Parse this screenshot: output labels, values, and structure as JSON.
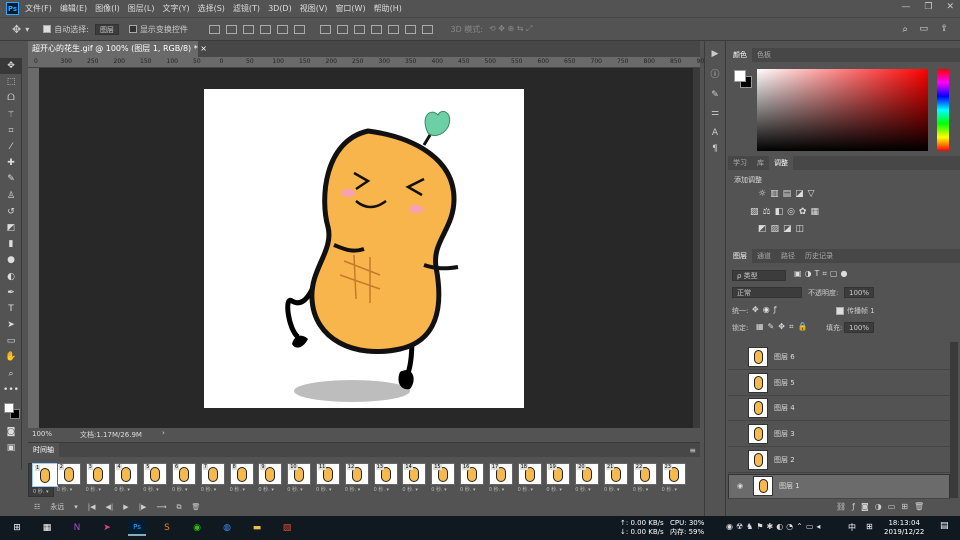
{
  "menubar": {
    "items": [
      "文件(F)",
      "编辑(E)",
      "图像(I)",
      "图层(L)",
      "文字(Y)",
      "选择(S)",
      "滤镜(T)",
      "3D(D)",
      "视图(V)",
      "窗口(W)",
      "帮助(H)"
    ]
  },
  "options": {
    "auto_select_label": "自动选择:",
    "auto_select_value": "图层",
    "show_transform_label": "显示变换控件",
    "mode_3d_label": "3D 模式:"
  },
  "document": {
    "tab_title": "超开心的花生.gif @ 100% (图层 1, RGB/8) *",
    "zoom": "100%",
    "doc_size": "文档:1.17M/26.9M"
  },
  "ruler": {
    "ticks": [
      "0",
      "300",
      "250",
      "200",
      "150",
      "100",
      "50",
      "0",
      "50",
      "100",
      "150",
      "200",
      "250",
      "300",
      "350",
      "400",
      "450",
      "500",
      "550",
      "600",
      "650",
      "700",
      "750",
      "800",
      "850",
      "900"
    ]
  },
  "timeline": {
    "tab_label": "时间轴",
    "loop_label": "永远",
    "frame_time": "0 秒.",
    "frames": [
      "1",
      "2",
      "3",
      "4",
      "5",
      "6",
      "7",
      "8",
      "9",
      "10",
      "11",
      "12",
      "13",
      "14",
      "15",
      "16",
      "17",
      "18",
      "19",
      "20",
      "21",
      "22",
      "23"
    ]
  },
  "color_panel": {
    "tabs": [
      "颜色",
      "色板"
    ],
    "foreground": "#ffffff",
    "background": "#000000"
  },
  "adjust_panel": {
    "tabs": [
      "学习",
      "库",
      "调整"
    ],
    "title": "添加调整"
  },
  "layers_panel": {
    "tabs": [
      "图层",
      "通道",
      "路径",
      "历史记录"
    ],
    "filter_label": "ρ 类型",
    "blend_mode": "正常",
    "opacity_label": "不透明度:",
    "opacity_value": "100%",
    "unify_label": "统一:",
    "propagate_label": "传播帧 1",
    "lock_label": "锁定:",
    "fill_label": "填充:",
    "fill_value": "100%",
    "layers": [
      {
        "name": "图层 6",
        "selected": false
      },
      {
        "name": "图层 5",
        "selected": false
      },
      {
        "name": "图层 4",
        "selected": false
      },
      {
        "name": "图层 3",
        "selected": false
      },
      {
        "name": "图层 2",
        "selected": false
      },
      {
        "name": "图层 1",
        "selected": true
      }
    ]
  },
  "taskbar": {
    "net_up": "↑: 0.00 KB/s",
    "net_down": "↓: 0.00 KB/s",
    "cpu": "CPU: 30%",
    "mem": "内存: 59%",
    "ime": "中",
    "time": "18:13:04",
    "date": "2019/12/22"
  }
}
